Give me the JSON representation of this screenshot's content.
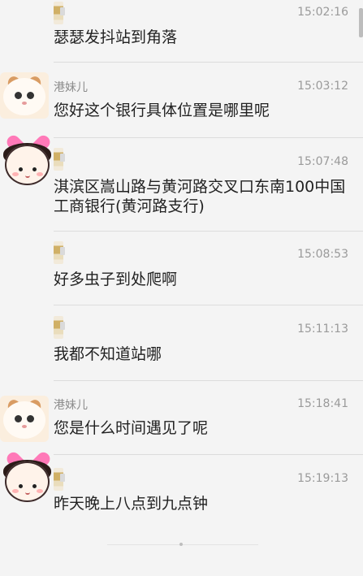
{
  "messages": [
    {
      "name": "",
      "time": "15:02:16",
      "text": "瑟瑟发抖站到角落",
      "avatar_icon": "none"
    },
    {
      "name": "港妹儿",
      "time": "15:03:12",
      "text": "您好这个银行具体位置是哪里呢",
      "avatar_icon": "cat-avatar-icon"
    },
    {
      "name": "",
      "time": "15:07:48",
      "text": "淇滨区嵩山路与黄河路交叉口东南100中国工商银行(黄河路支行)",
      "avatar_icon": "girl-avatar-icon"
    },
    {
      "name": "",
      "time": "15:08:53",
      "text": "好多虫子到处爬啊",
      "avatar_icon": "none"
    },
    {
      "name": "",
      "time": "15:11:13",
      "text": "我都不知道站哪",
      "avatar_icon": "none"
    },
    {
      "name": "港妹儿",
      "time": "15:18:41",
      "text": "您是什么时间遇见了呢",
      "avatar_icon": "cat-avatar-icon"
    },
    {
      "name": "",
      "time": "15:19:13",
      "text": "昨天晚上八点到九点钟",
      "avatar_icon": "girl-avatar-icon"
    }
  ],
  "colors": {
    "background": "#f4f4f4",
    "text": "#222222",
    "time": "#9a9a9a",
    "divider": "#dcdcdc"
  }
}
